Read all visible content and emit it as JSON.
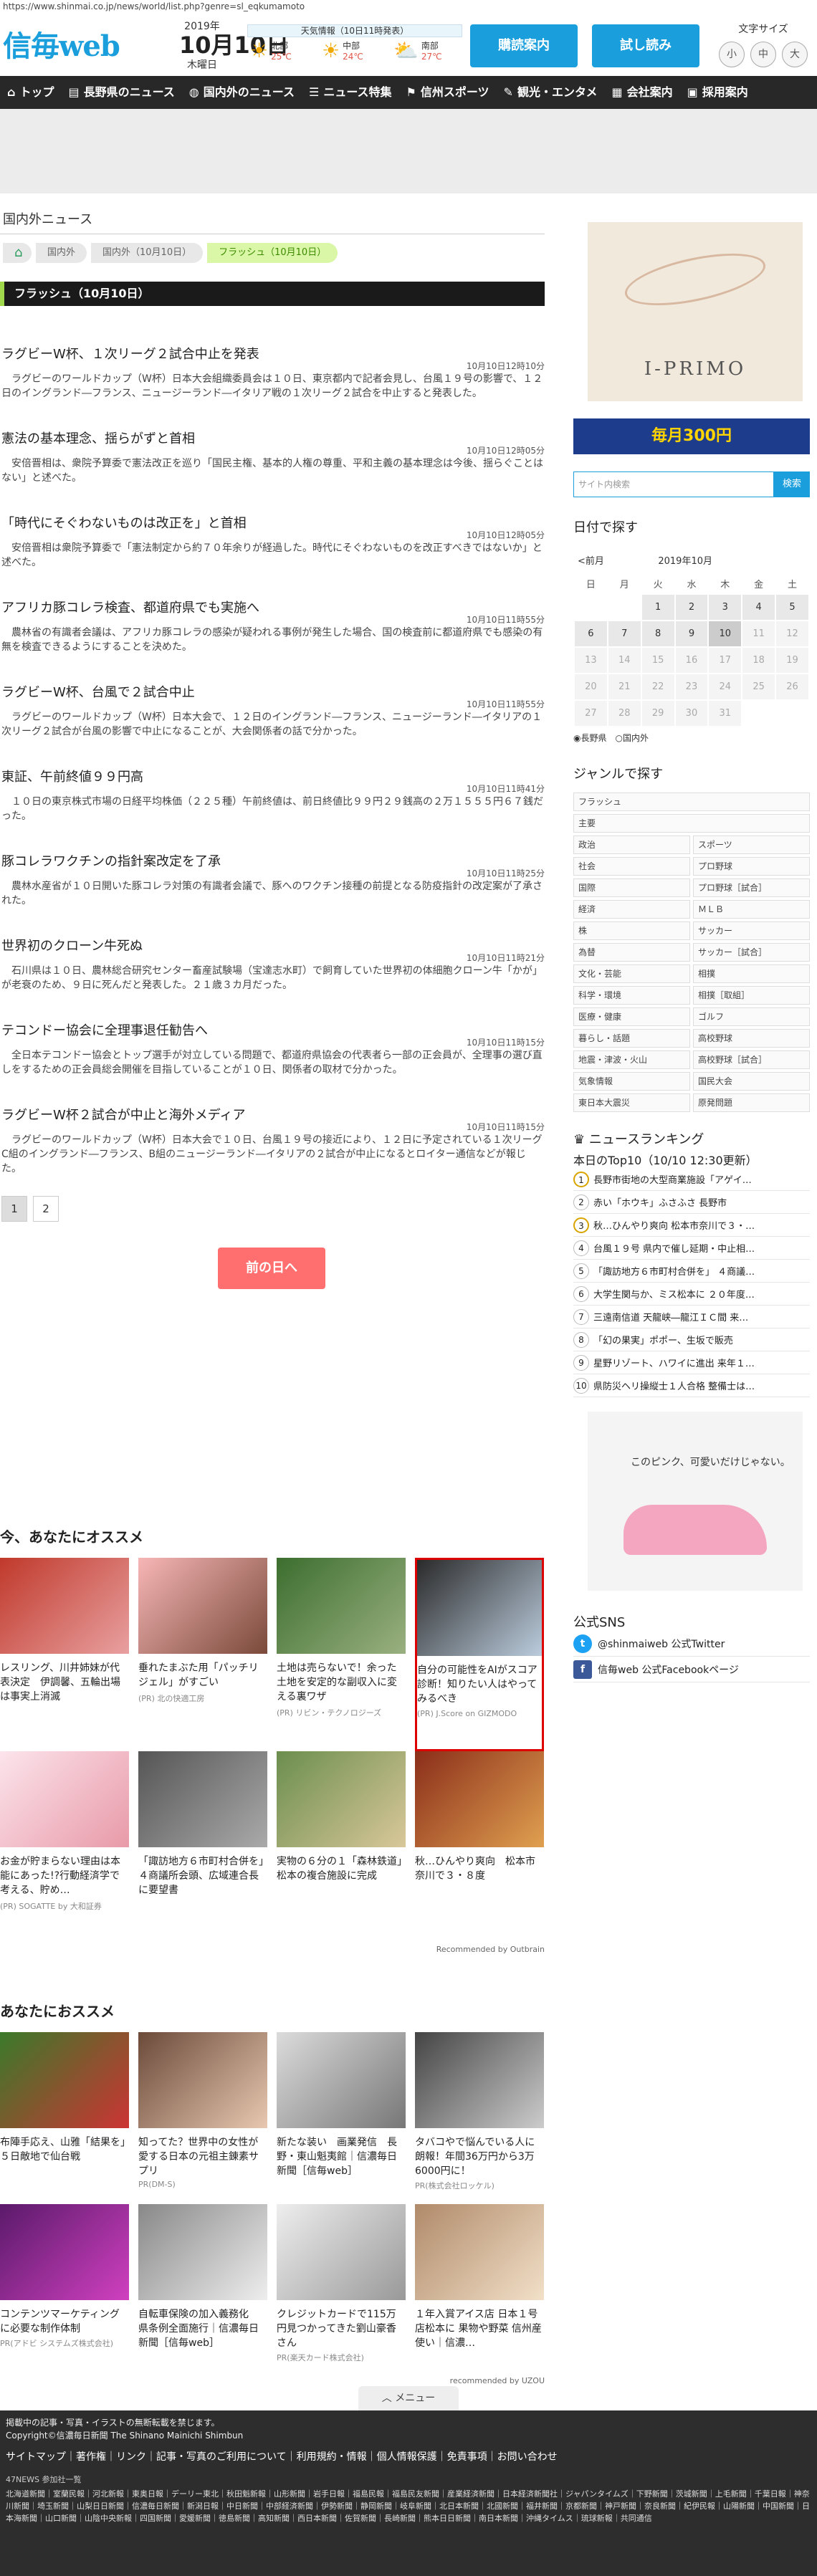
{
  "url": "https://www.shinmai.co.jp/news/world/list.php?genre=sl_eqkumamoto",
  "header": {
    "logo": "信毎web",
    "year": "2019年",
    "date": "10月10日",
    "weekday": "木曜日",
    "weather_title": "天気情報（10日11時発表）",
    "weather": [
      {
        "area": "北部",
        "temp": "25℃"
      },
      {
        "area": "中部",
        "temp": "24℃"
      },
      {
        "area": "南部",
        "temp": "27℃"
      }
    ],
    "btn_subscribe": "購読案内",
    "btn_trial": "試し読み",
    "font_label": "文字サイズ",
    "font_sizes": [
      "小",
      "中",
      "大"
    ]
  },
  "nav": [
    "トップ",
    "長野県のニュース",
    "国内外のニュース",
    "ニュース特集",
    "信州スポーツ",
    "観光・エンタメ",
    "会社案内",
    "採用案内"
  ],
  "main": {
    "section_title": "国内外ニュース",
    "breadcrumb": [
      "国内外",
      "国内外（10月10日）",
      "フラッシュ（10月10日）"
    ],
    "bar_title": "フラッシュ（10月10日）",
    "news": [
      {
        "title": "ラグビーW杯、１次リーグ２試合中止を発表",
        "time": "10月10日12時10分",
        "desc": "　ラグビーのワールドカップ（W杯）日本大会組織委員会は１０日、東京都内で記者会見し、台風１９号の影響で、１２日のイングランド―フランス、ニュージーランド―イタリア戦の１次リーグ２試合を中止すると発表した。"
      },
      {
        "title": "憲法の基本理念、揺らがずと首相",
        "time": "10月10日12時05分",
        "desc": "　安倍晋相は、衆院予算委で憲法改正を巡り「国民主権、基本的人権の尊重、平和主義の基本理念は今後、揺らぐことはない」と述べた。"
      },
      {
        "title": "「時代にそぐわないものは改正を」と首相",
        "time": "10月10日12時05分",
        "desc": "　安倍晋相は衆院予算委で「憲法制定から約７０年余りが経過した。時代にそぐわないものを改正すべきではないか」と述べた。"
      },
      {
        "title": "アフリカ豚コレラ検査、都道府県でも実施へ",
        "time": "10月10日11時55分",
        "desc": "　農林省の有識者会議は、アフリカ豚コレラの感染が疑われる事例が発生した場合、国の検査前に都道府県でも感染の有無を検査できるようにすることを決めた。"
      },
      {
        "title": "ラグビーW杯、台風で２試合中止",
        "time": "10月10日11時55分",
        "desc": "　ラグビーのワールドカップ（W杯）日本大会で、１２日のイングランド―フランス、ニュージーランド―イタリアの１次リーグ２試合が台風の影響で中止になることが、大会関係者の話で分かった。"
      },
      {
        "title": "東証、午前終値９９円高",
        "time": "10月10日11時41分",
        "desc": "　１０日の東京株式市場の日経平均株価（２２５種）午前終値は、前日終値比９９円２９銭高の２万１５５５円６７銭だった。"
      },
      {
        "title": "豚コレラワクチンの指針案改定を了承",
        "time": "10月10日11時25分",
        "desc": "　農林水産省が１０日開いた豚コレラ対策の有識者会議で、豚へのワクチン接種の前提となる防疫指針の改定案が了承された。"
      },
      {
        "title": "世界初のクローン牛死ぬ",
        "time": "10月10日11時21分",
        "desc": "　石川県は１０日、農林総合研究センター畜産試験場（宝達志水町）で飼育していた世界初の体細胞クローン牛「かが」が老衰のため、９日に死んだと発表した。２１歳３カ月だった。"
      },
      {
        "title": "テコンドー協会に全理事退任勧告へ",
        "time": "10月10日11時15分",
        "desc": "　全日本テコンドー協会とトップ選手が対立している問題で、都道府県協会の代表者ら一部の正会員が、全理事の選び直しをするための正会員総会開催を目指していることが１０日、関係者の取材で分かった。"
      },
      {
        "title": "ラグビーW杯２試合が中止と海外メディア",
        "time": "10月10日11時15分",
        "desc": "　ラグビーのワールドカップ（W杯）日本大会で１０日、台風１９号の接近により、１２日に予定されている１次リーグC組のイングランド―フランス、B組のニュージーランド―イタリアの２試合が中止になるとロイター通信などが報じた。"
      }
    ],
    "pages": [
      "1",
      "2"
    ],
    "prev_button": "前の日へ",
    "rec_title": "今、あなたにオススメ",
    "rec1": [
      {
        "title": "レスリング、川井姉妹が代表決定　伊調馨、五輪出場は事実上消滅",
        "source": ""
      },
      {
        "title": "垂れたまぶた用「パッチリジェル」がすごい",
        "source": "(PR) 北の快適工房"
      },
      {
        "title": "土地は売らないで！余った土地を安定的な副収入に変える裏ワザ",
        "source": "(PR) リビン・テクノロジーズ"
      },
      {
        "title": "自分の可能性をAIがスコア診断！知りたい人はやってみるべき",
        "source": "(PR) J.Score on GIZMODO"
      },
      {
        "title": "お金が貯まらない理由は本能にあった!?行動経済学で考える、貯め…",
        "source": "(PR) SOGATTE by 大和証券"
      },
      {
        "title": "「諏訪地方６市町村合併を」　４商議所会頭、広域連合長に要望書",
        "source": ""
      },
      {
        "title": "実物の６分の１「森林鉄道」　松本の複合施設に完成",
        "source": ""
      },
      {
        "title": "秋…ひんやり爽向　松本市奈川で３・８度",
        "source": ""
      }
    ],
    "outbrain": "Recommended by Outbrain",
    "rec2_title": "あなたにおススメ",
    "rec2": [
      {
        "title": "布陣手応え、山雅「結果を」　５日敵地で仙台戦",
        "source": ""
      },
      {
        "title": "知ってた？世界中の女性が愛する日本の元祖主錬素サプリ",
        "source": "PR(DM-S)"
      },
      {
        "title": "新たな装い　画業発信　長野・東山魁夷館｜信濃毎日新聞［信毎web］",
        "source": ""
      },
      {
        "title": "タバコやで悩んでいる人に朗報！年間36万円から3万6000円に！",
        "source": "PR(株式会社ロッケル)"
      },
      {
        "title": "コンテンツマーケティングに必要な制作体制",
        "source": "PR(アドビ システムズ株式会社)"
      },
      {
        "title": "自転車保険の加入義務化　県条例全面施行｜信濃毎日新聞［信毎web］",
        "source": ""
      },
      {
        "title": "クレジットカードで115万円見つかってきた劉山豪香さん",
        "source": "PR(楽天カード株式会社)"
      },
      {
        "title": "１年入賞アイス店 日本１号店松本に 果物や野菜 信州産使い｜信濃…",
        "source": ""
      }
    ],
    "uzou": "recommended by UZOU",
    "menu": "メニュー"
  },
  "side": {
    "ad_brand": "I-PRIMO",
    "banner": "毎月300円",
    "search_placeholder": "サイト内検索",
    "search_btn": "検索",
    "date_title": "日付で探す",
    "cal_prev": "<前月",
    "cal_month": "2019年10月",
    "weekdays": [
      "日",
      "月",
      "火",
      "水",
      "木",
      "金",
      "土"
    ],
    "radio": "◉長野県　○国内外",
    "genre_title": "ジャンルで探す",
    "genre_full": [
      "フラッシュ",
      "主要"
    ],
    "genres": [
      "政治",
      "スポーツ",
      "社会",
      "プロ野球",
      "国際",
      "プロ野球［試合］",
      "経済",
      "ＭＬＢ",
      "株",
      "サッカー",
      "為替",
      "サッカー［試合］",
      "文化・芸能",
      "相撲",
      "科学・環境",
      "相撲［取組］",
      "医療・健康",
      "ゴルフ",
      "暮らし・話題",
      "高校野球",
      "地震・津波・火山",
      "高校野球［試合］",
      "気象情報",
      "国民大会",
      "東日本大震災",
      "原発問題"
    ],
    "rank_title": "ニュースランキング",
    "rank_sub": "本日のTop10（10/10 12:30更新）",
    "ranking": [
      "長野市街地の大型商業施設「アゲイ…",
      "赤い「ホウキ」ふさふさ 長野市",
      "秋…ひんやり爽向 松本市奈川で３・…",
      "台風１９号 県内で催し延期・中止相…",
      "「諏訪地方６市町村合併を」 ４商議…",
      "大学生関与か、ミス松本に ２０年度…",
      "三遠南信道 天龍峡―龍江ＩＣ間 来…",
      "「幻の果実」ポポー、生坂で販売",
      "星野リゾート、ハワイに進出 来年１…",
      "県防災ヘリ操縦士１人合格 整備士は…"
    ],
    "ad2": "このピンク、可愛いだけじゃない。",
    "sns_title": "公式SNS",
    "twitter": "@shinmaiweb 公式Twitter",
    "facebook": "信毎web 公式Facebookページ"
  },
  "footer": {
    "l1": "掲載中の記事・写真・イラストの無断転載を禁じます。",
    "l1b": "Copyright©信濃毎日新聞 The Shinano Mainichi Shimbun",
    "links": "サイトマップ｜著作権｜リンク｜記事・写真のご利用について｜利用規約・情報｜個人情報保護｜免責事項｜お問い合わせ",
    "l3": "47NEWS 参加社一覧",
    "l4": "北海道新聞｜室蘭民報｜河北新報｜東奥日報｜デーリー東北｜秋田魁新報｜山形新聞｜岩手日報｜福島民報｜福島民友新聞｜産業経済新聞｜日本経済新聞社｜ジャパンタイムズ｜下野新聞｜茨城新聞｜上毛新聞｜千葉日報｜神奈川新聞｜埼玉新聞｜山梨日日新聞｜信濃毎日新聞｜新潟日報｜中日新聞｜中部経済新聞｜伊勢新聞｜静岡新聞｜岐阜新聞｜北日本新聞｜北國新聞｜福井新聞｜京都新聞｜神戸新聞｜奈良新聞｜紀伊民報｜山陽新聞｜中国新聞｜日本海新聞｜山口新聞｜山陰中央新報｜四国新聞｜愛媛新聞｜徳島新聞｜高知新聞｜西日本新聞｜佐賀新聞｜長崎新聞｜熊本日日新聞｜南日本新聞｜沖縄タイムス｜琉球新報｜共同通信"
  }
}
